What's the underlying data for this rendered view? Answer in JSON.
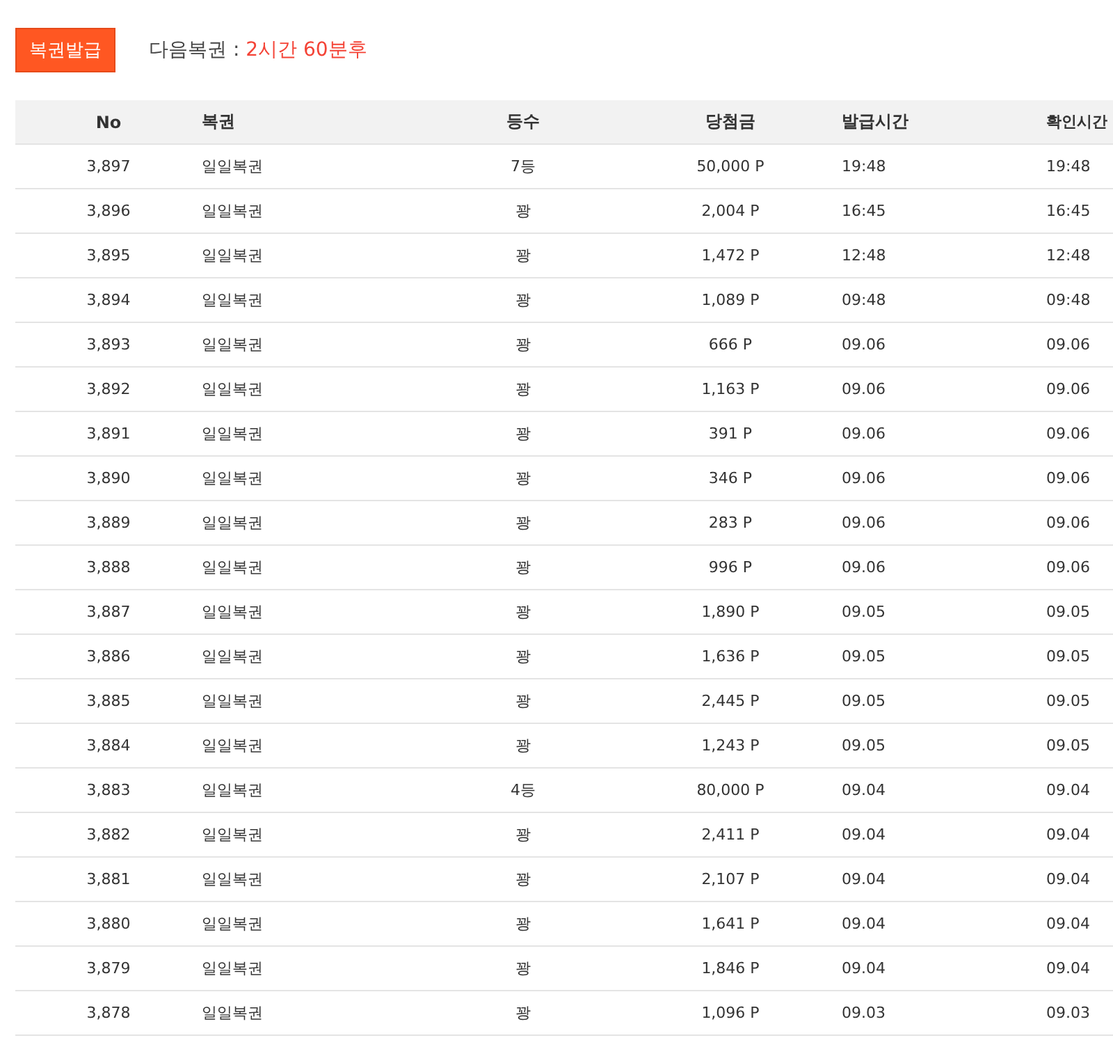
{
  "issue_button": "복권발급",
  "next_ticket": {
    "label": "다음복권 : ",
    "value": "2시간 60분후"
  },
  "table": {
    "columns": [
      "No",
      "복권",
      "등수",
      "당첨금",
      "발급시간",
      "확인시간"
    ],
    "rows": [
      [
        "3,897",
        "일일복권",
        "7등",
        "50,000 P",
        "19:48",
        "19:48"
      ],
      [
        "3,896",
        "일일복권",
        "꽝",
        "2,004 P",
        "16:45",
        "16:45"
      ],
      [
        "3,895",
        "일일복권",
        "꽝",
        "1,472 P",
        "12:48",
        "12:48"
      ],
      [
        "3,894",
        "일일복권",
        "꽝",
        "1,089 P",
        "09:48",
        "09:48"
      ],
      [
        "3,893",
        "일일복권",
        "꽝",
        "666 P",
        "09.06",
        "09.06"
      ],
      [
        "3,892",
        "일일복권",
        "꽝",
        "1,163 P",
        "09.06",
        "09.06"
      ],
      [
        "3,891",
        "일일복권",
        "꽝",
        "391 P",
        "09.06",
        "09.06"
      ],
      [
        "3,890",
        "일일복권",
        "꽝",
        "346 P",
        "09.06",
        "09.06"
      ],
      [
        "3,889",
        "일일복권",
        "꽝",
        "283 P",
        "09.06",
        "09.06"
      ],
      [
        "3,888",
        "일일복권",
        "꽝",
        "996 P",
        "09.06",
        "09.06"
      ],
      [
        "3,887",
        "일일복권",
        "꽝",
        "1,890 P",
        "09.05",
        "09.05"
      ],
      [
        "3,886",
        "일일복권",
        "꽝",
        "1,636 P",
        "09.05",
        "09.05"
      ],
      [
        "3,885",
        "일일복권",
        "꽝",
        "2,445 P",
        "09.05",
        "09.05"
      ],
      [
        "3,884",
        "일일복권",
        "꽝",
        "1,243 P",
        "09.05",
        "09.05"
      ],
      [
        "3,883",
        "일일복권",
        "4등",
        "80,000 P",
        "09.04",
        "09.04"
      ],
      [
        "3,882",
        "일일복권",
        "꽝",
        "2,411 P",
        "09.04",
        "09.04"
      ],
      [
        "3,881",
        "일일복권",
        "꽝",
        "2,107 P",
        "09.04",
        "09.04"
      ],
      [
        "3,880",
        "일일복권",
        "꽝",
        "1,641 P",
        "09.04",
        "09.04"
      ],
      [
        "3,879",
        "일일복권",
        "꽝",
        "1,846 P",
        "09.04",
        "09.04"
      ],
      [
        "3,878",
        "일일복권",
        "꽝",
        "1,096 P",
        "09.03",
        "09.03"
      ]
    ]
  }
}
